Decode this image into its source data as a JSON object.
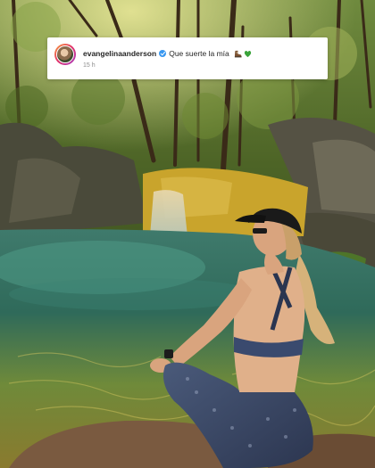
{
  "comment": {
    "username": "evangelinaanderson",
    "text": "Que suerte la mía",
    "timestamp": "15 h",
    "emojis": [
      "hiking-boot-icon",
      "green-heart-icon"
    ],
    "verified": true
  },
  "photo": {
    "description_icon": "nature-photo"
  },
  "colors": {
    "verified_badge": "#3897f0",
    "card_background": "#ffffff",
    "timestamp": "#8e8e8e"
  }
}
